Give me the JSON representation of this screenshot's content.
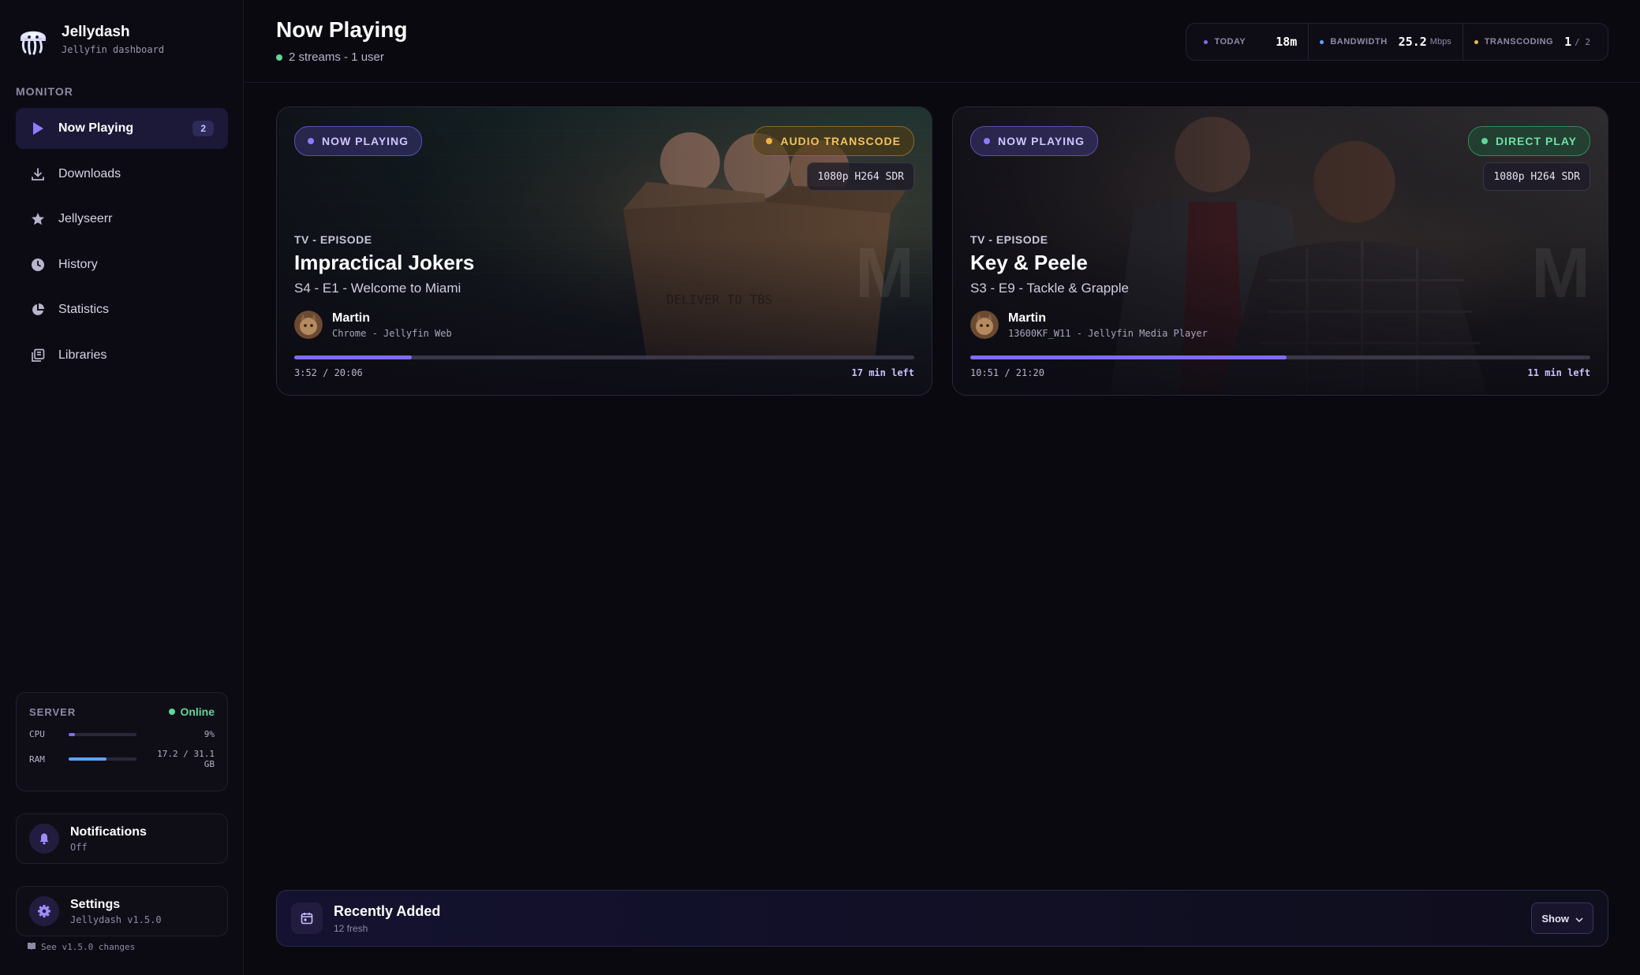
{
  "app": {
    "name": "Jellydash",
    "subtitle": "Jellyfin dashboard"
  },
  "sidebar": {
    "section": "MONITOR",
    "items": [
      {
        "label": "Now Playing",
        "icon": "play-icon",
        "badge": "2",
        "active": true
      },
      {
        "label": "Downloads",
        "icon": "download-icon"
      },
      {
        "label": "Jellyseerr",
        "icon": "star-icon"
      },
      {
        "label": "History",
        "icon": "clock-icon"
      },
      {
        "label": "Statistics",
        "icon": "pie-chart-icon"
      },
      {
        "label": "Libraries",
        "icon": "library-icon"
      }
    ],
    "server": {
      "title": "SERVER",
      "status": "Online",
      "cpu": {
        "label": "CPU",
        "value": "9%",
        "fraction": 0.09
      },
      "ram": {
        "label": "RAM",
        "value": "17.2 / 31.1 GB",
        "fraction": 0.553
      }
    },
    "notifications": {
      "title": "Notifications",
      "sub": "Off"
    },
    "settings": {
      "title": "Settings",
      "sub": "Jellydash v1.5.0"
    },
    "changes": "See v1.5.0 changes"
  },
  "header": {
    "title": "Now Playing",
    "sub": "2 streams - 1 user",
    "stats": [
      {
        "key": "TODAY",
        "value": "18m",
        "unit": "",
        "color": "#7f6cf5"
      },
      {
        "key": "BANDWIDTH",
        "value": "25.2",
        "unit": "Mbps",
        "color": "#5aa6ff"
      },
      {
        "key": "TRANSCODING",
        "value": "1",
        "unit": "/ 2",
        "color": "#f0b542"
      }
    ]
  },
  "sessions": [
    {
      "status": "NOW PLAYING",
      "mode": "AUDIO TRANSCODE",
      "mode_color": "#f0b542",
      "quality": "1080p H264 SDR",
      "kind": "TV - EPISODE",
      "title": "Impractical Jokers",
      "episode": "S4 - E1 - Welcome to Miami",
      "user": "Martin",
      "device": "Chrome - Jellyfin Web",
      "position": "3:52 / 20:06",
      "remaining": "17 min left",
      "progress": 0.19
    },
    {
      "status": "NOW PLAYING",
      "mode": "DIRECT PLAY",
      "mode_color": "#5fd69a",
      "quality": "1080p H264 SDR",
      "kind": "TV - EPISODE",
      "title": "Key & Peele",
      "episode": "S3 - E9 - Tackle & Grapple",
      "user": "Martin",
      "device": "13600KF_W11 - Jellyfin Media Player",
      "position": "10:51 / 21:20",
      "remaining": "11 min left",
      "progress": 0.51
    }
  ],
  "recent": {
    "title": "Recently Added",
    "sub": "12 fresh",
    "button": "Show"
  }
}
